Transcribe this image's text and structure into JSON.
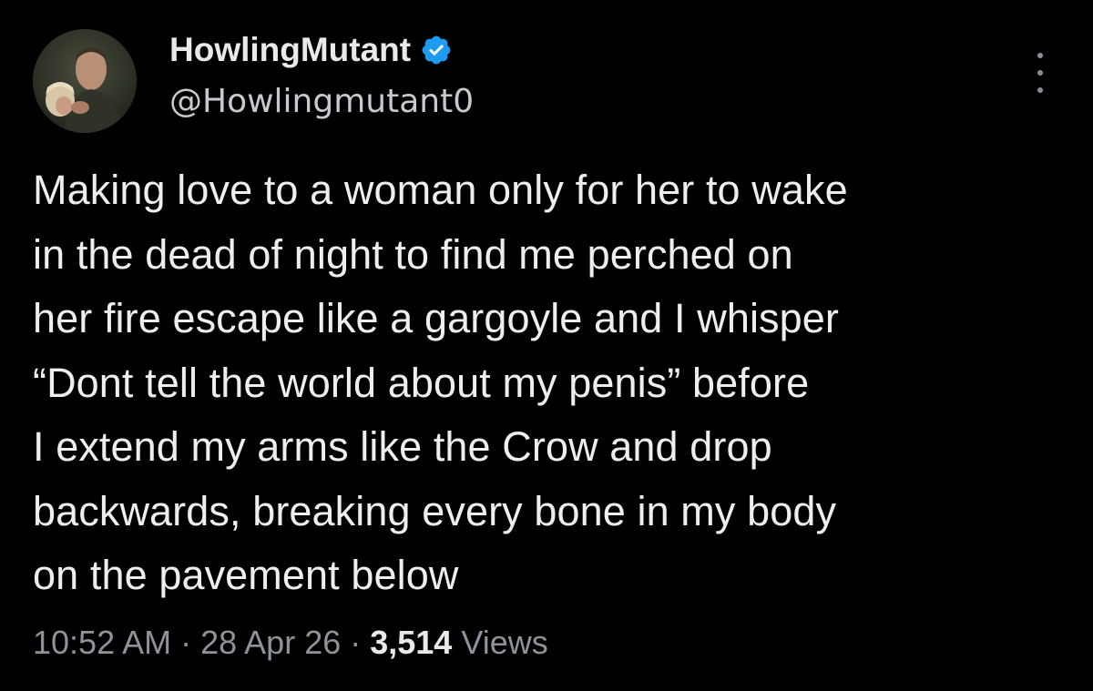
{
  "user": {
    "display_name": "HowlingMutant",
    "handle": "@Howlingmutant0",
    "verified_icon": "verified-badge-icon",
    "avatar": "profile-photo"
  },
  "menu": {
    "icon": "more-vertical-icon"
  },
  "tweet": {
    "text": "Making love to a woman only for her to wake\nin the dead of night to find me perched on\nher fire escape like a gargoyle and I whisper\n“Dont tell the world about my penis” before\nI extend my arms like the Crow and drop\nbackwards, breaking every bone in my body\non the pavement below"
  },
  "meta": {
    "time": "10:52 AM",
    "separator": "·",
    "date": "28 Apr 26",
    "views_count": "3,514",
    "views_label": "Views"
  },
  "colors": {
    "background": "#000000",
    "text": "#e7e9ea",
    "secondary": "#8d9399",
    "verified": "#1d9bf0"
  }
}
